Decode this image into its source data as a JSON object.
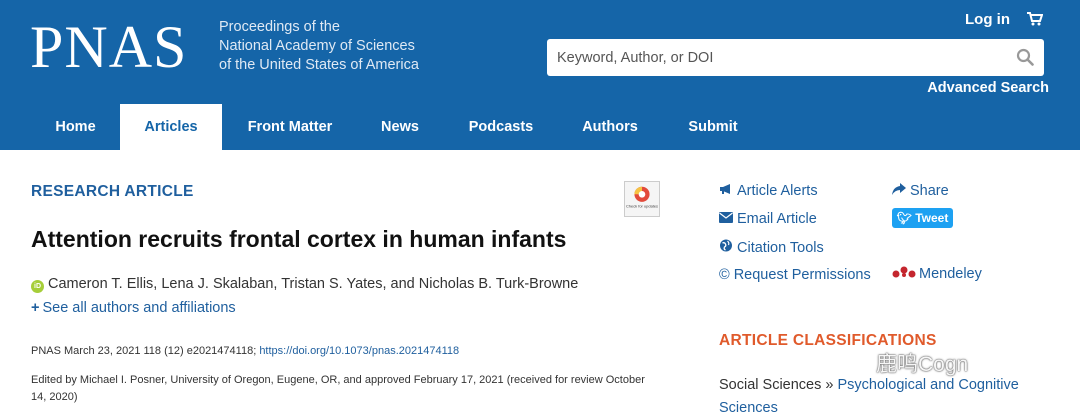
{
  "header": {
    "logo": "PNAS",
    "tagline": [
      "Proceedings of the",
      "National Academy of Sciences",
      "of the United States of America"
    ],
    "login": "Log in",
    "search_placeholder": "Keyword, Author, or DOI",
    "advanced_search": "Advanced Search"
  },
  "nav": {
    "items": [
      "Home",
      "Articles",
      "Front Matter",
      "News",
      "Podcasts",
      "Authors",
      "Submit"
    ],
    "active": "Articles"
  },
  "article": {
    "kicker": "RESEARCH ARTICLE",
    "check_badge": "Check for updates",
    "title": "Attention recruits frontal cortex in human infants",
    "authors": "Cameron T. Ellis, Lena J. Skalaban, Tristan S. Yates, and Nicholas B. Turk-Browne",
    "orcid_label": "iD",
    "see_all": "See all authors and affiliations",
    "citation_prefix": "PNAS March 23, 2021 118 (12) e2021474118; ",
    "doi": "https://doi.org/10.1073/pnas.2021474118",
    "edited": "Edited by Michael I. Posner, University of Oregon, Eugene, OR, and approved February 17, 2021 (received for review October 14, 2020)"
  },
  "tools": {
    "article_alerts": "Article Alerts",
    "email_article": "Email Article",
    "citation_tools": "Citation Tools",
    "request_permissions": "© Request Permissions",
    "share": "Share",
    "tweet": "Tweet",
    "mendeley": "Mendeley"
  },
  "classifications": {
    "heading": "ARTICLE CLASSIFICATIONS",
    "category": "Social Sciences",
    "separator": " » ",
    "subcategory": "Psychological and Cognitive Sciences"
  },
  "watermark": "鹿鸣Cogn",
  "colors": {
    "header_bg": "#1565a8",
    "link": "#1f5f9e",
    "accent_orange": "#e05a2b",
    "twitter": "#1da1f2"
  }
}
